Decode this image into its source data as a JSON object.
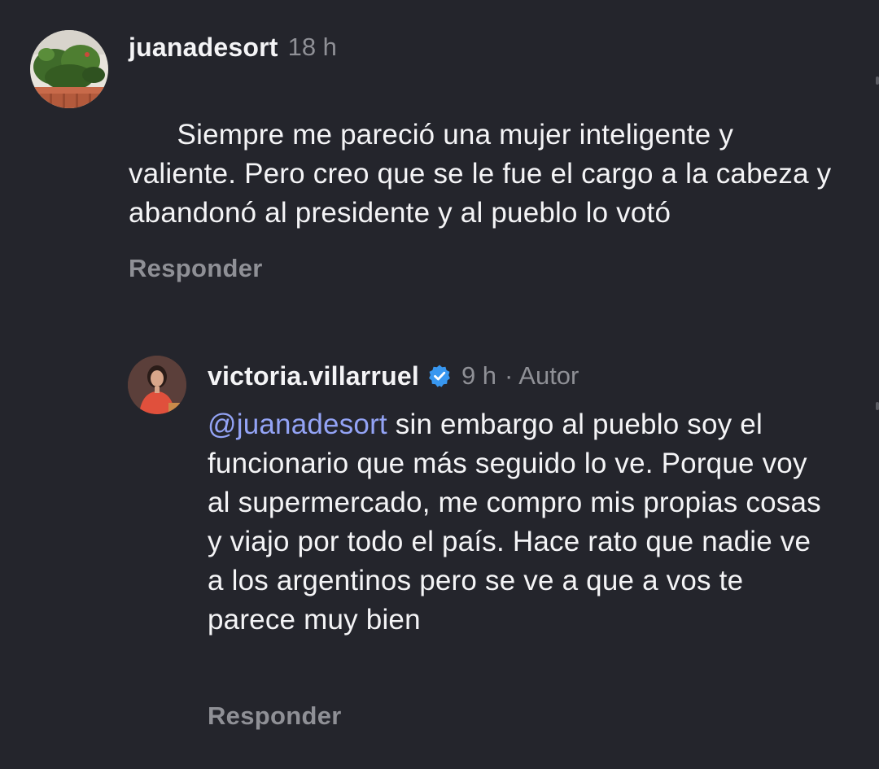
{
  "comments": [
    {
      "username": "juanadesort",
      "time": "18 h",
      "text": "Siempre me pareció una mujer inteligente y valiente. Pero creo que se le fue el cargo a la cabeza y abandonó al presidente y al pueblo lo votó",
      "reply_label": "Responder"
    },
    {
      "username": "victoria.villarruel",
      "verified": true,
      "time": "9 h",
      "author_tag": "· Autor",
      "mention": "@juanadesort",
      "text": " sin embargo al pueblo soy el funcionario que más seguido lo ve. Porque voy al supermercado, me compro mis propias cosas y viajo por todo el país. Hace rato que nadie ve a los argentinos pero se ve a que a vos te parece muy bien",
      "reply_label": "Responder"
    }
  ],
  "colors": {
    "background": "#24252c",
    "text": "#f4f4f6",
    "meta": "#8f9096",
    "mention": "#93a3f5",
    "verified_badge": "#3897f0"
  }
}
